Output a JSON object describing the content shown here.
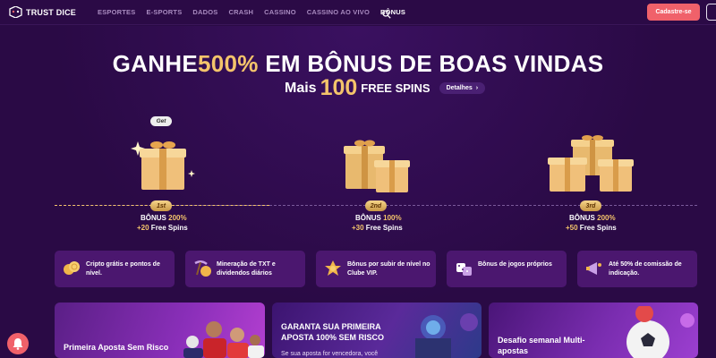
{
  "header": {
    "logo_text": "TRUST DICE",
    "nav": [
      {
        "label": "ESPORTES",
        "active": false
      },
      {
        "label": "E-SPORTS",
        "active": false
      },
      {
        "label": "DADOS",
        "active": false
      },
      {
        "label": "CRASH",
        "active": false
      },
      {
        "label": "CASSINO",
        "active": false
      },
      {
        "label": "CASSINO AO VIVO",
        "active": false
      },
      {
        "label": "BÔNUS",
        "active": true
      }
    ],
    "search_icon": "search-icon",
    "signup_label": "Cadastre-se"
  },
  "hero": {
    "headline_pre": "GANHE",
    "headline_pct": "500%",
    "headline_post": " EM BÔNUS DE BOAS VINDAS",
    "sub_mais": "Mais",
    "sub_num": "100",
    "sub_fs": "FREE SPINS",
    "details_label": "Detalhes"
  },
  "tiers": [
    {
      "badge": "1st",
      "bonus_label": "BÔNUS ",
      "bonus_pct": "200%",
      "spins_num": "+20",
      "spins_label": " Free Spins",
      "bubble": "Get"
    },
    {
      "badge": "2nd",
      "bonus_label": "BÔNUS ",
      "bonus_pct": "100%",
      "spins_num": "+30",
      "spins_label": " Free Spins"
    },
    {
      "badge": "3rd",
      "bonus_label": "BÔNUS ",
      "bonus_pct": "200%",
      "spins_num": "+50",
      "spins_label": " Free Spins"
    }
  ],
  "features": [
    {
      "text": "Cripto grátis e pontos de nível.",
      "icon": "coins-icon"
    },
    {
      "text": "Mineração de TXT e dividendos diários",
      "icon": "pickaxe-icon"
    },
    {
      "text": "Bônus por subir de nível no Clube VIP.",
      "icon": "medal-icon"
    },
    {
      "text": "Bônus de jogos próprios",
      "icon": "dice-icon"
    },
    {
      "text": "Até 50% de comissão de indicação.",
      "icon": "megaphone-icon"
    }
  ],
  "promos": [
    {
      "title": "Primeira Aposta Sem Risco"
    },
    {
      "title": "GARANTA SUA PRIMEIRA APOSTA 100% SEM RISCO",
      "body": "Se sua aposta for vencedora, você"
    },
    {
      "title": "Desafio semanal Multi-apostas"
    }
  ],
  "colors": {
    "accent": "#f0616a",
    "gold": "#f4c46b",
    "bg": "#2a0a45",
    "card": "#4b176f"
  }
}
